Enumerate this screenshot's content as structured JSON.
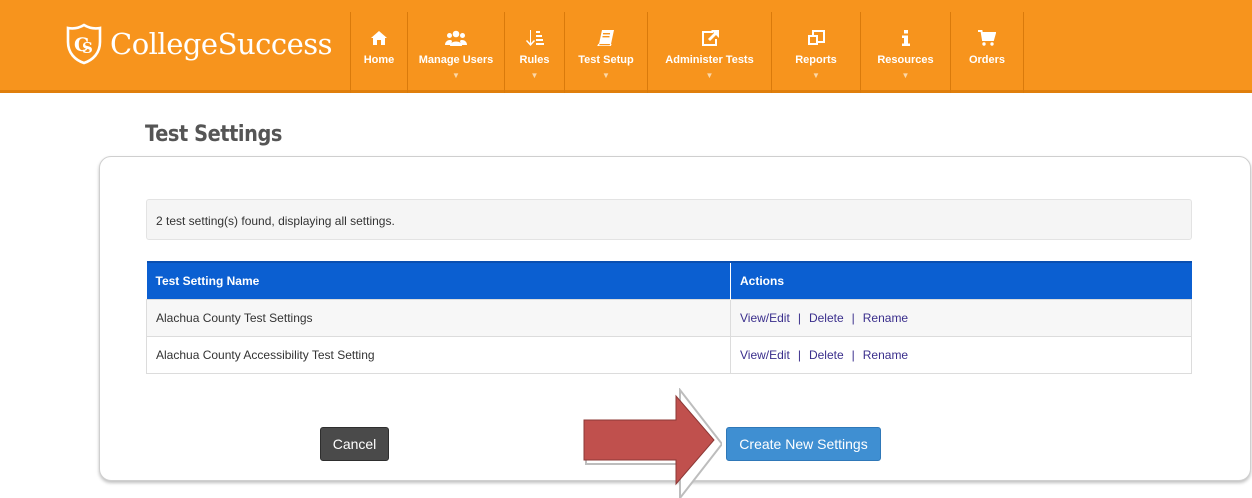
{
  "brand": {
    "name": "CollegeSuccess",
    "primary_color": "#f7941d",
    "header_color": "#0b5fd1"
  },
  "nav": [
    {
      "label": "Home",
      "icon": "home-icon",
      "has_caret": false
    },
    {
      "label": "Manage Users",
      "icon": "users-icon",
      "has_caret": true
    },
    {
      "label": "Rules",
      "icon": "sort-list-icon",
      "has_caret": true
    },
    {
      "label": "Test Setup",
      "icon": "book-icon",
      "has_caret": true
    },
    {
      "label": "Administer Tests",
      "icon": "external-link-icon",
      "has_caret": true
    },
    {
      "label": "Reports",
      "icon": "copy-icon",
      "has_caret": true
    },
    {
      "label": "Resources",
      "icon": "info-icon",
      "has_caret": true
    },
    {
      "label": "Orders",
      "icon": "cart-icon",
      "has_caret": false
    }
  ],
  "page": {
    "title": "Test Settings",
    "info": "2 test setting(s) found, displaying all settings."
  },
  "table": {
    "headers": [
      "Test Setting Name",
      "Actions"
    ],
    "rows": [
      {
        "name": "Alachua County Test Settings",
        "actions": [
          "View/Edit",
          "Delete",
          "Rename"
        ]
      },
      {
        "name": "Alachua County Accessibility Test Setting",
        "actions": [
          "View/Edit",
          "Delete",
          "Rename"
        ]
      }
    ],
    "separator": "|"
  },
  "buttons": {
    "cancel": "Cancel",
    "create": "Create New Settings"
  }
}
